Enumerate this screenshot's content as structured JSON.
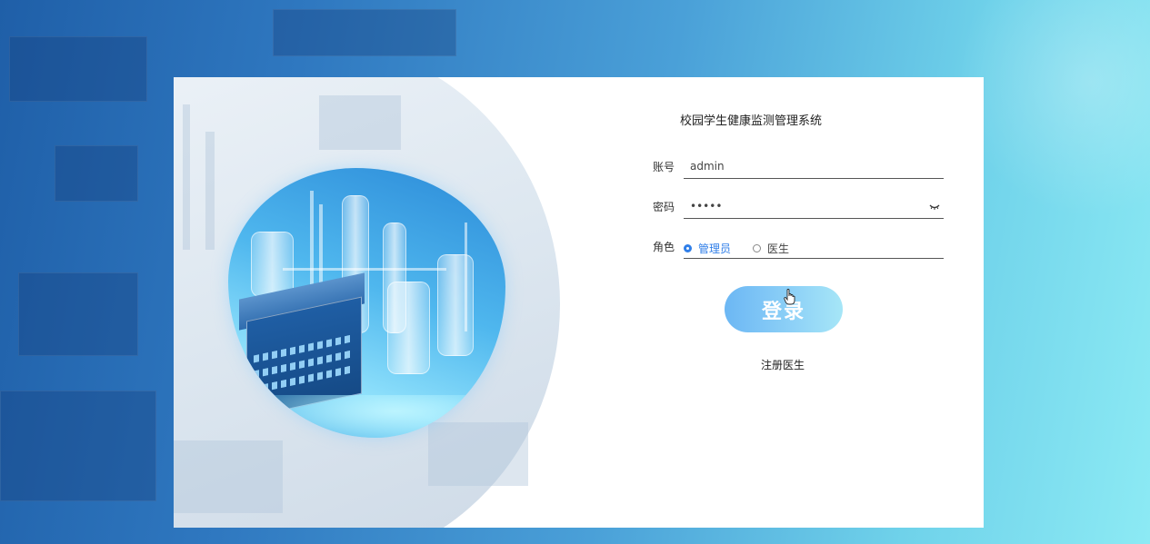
{
  "app": {
    "title": "校园学生健康监测管理系统"
  },
  "login_form": {
    "account": {
      "label": "账号",
      "value": "admin",
      "placeholder": ""
    },
    "password": {
      "label": "密码",
      "value": "•••••",
      "placeholder": "",
      "toggle_icon": "eye-closed-icon"
    },
    "role": {
      "label": "角色",
      "options": [
        {
          "label": "管理员",
          "selected": true
        },
        {
          "label": "医生",
          "selected": false
        }
      ]
    },
    "submit_label": "登录",
    "register_label": "注册医生"
  },
  "colors": {
    "accent": "#2f7ee8",
    "button_gradient_start": "#6cb7f4",
    "button_gradient_end": "#a6e6f7",
    "background_start": "#1f5fa8",
    "background_end": "#8ceaf4"
  },
  "icons": {
    "cursor": "hand-pointer-icon"
  }
}
